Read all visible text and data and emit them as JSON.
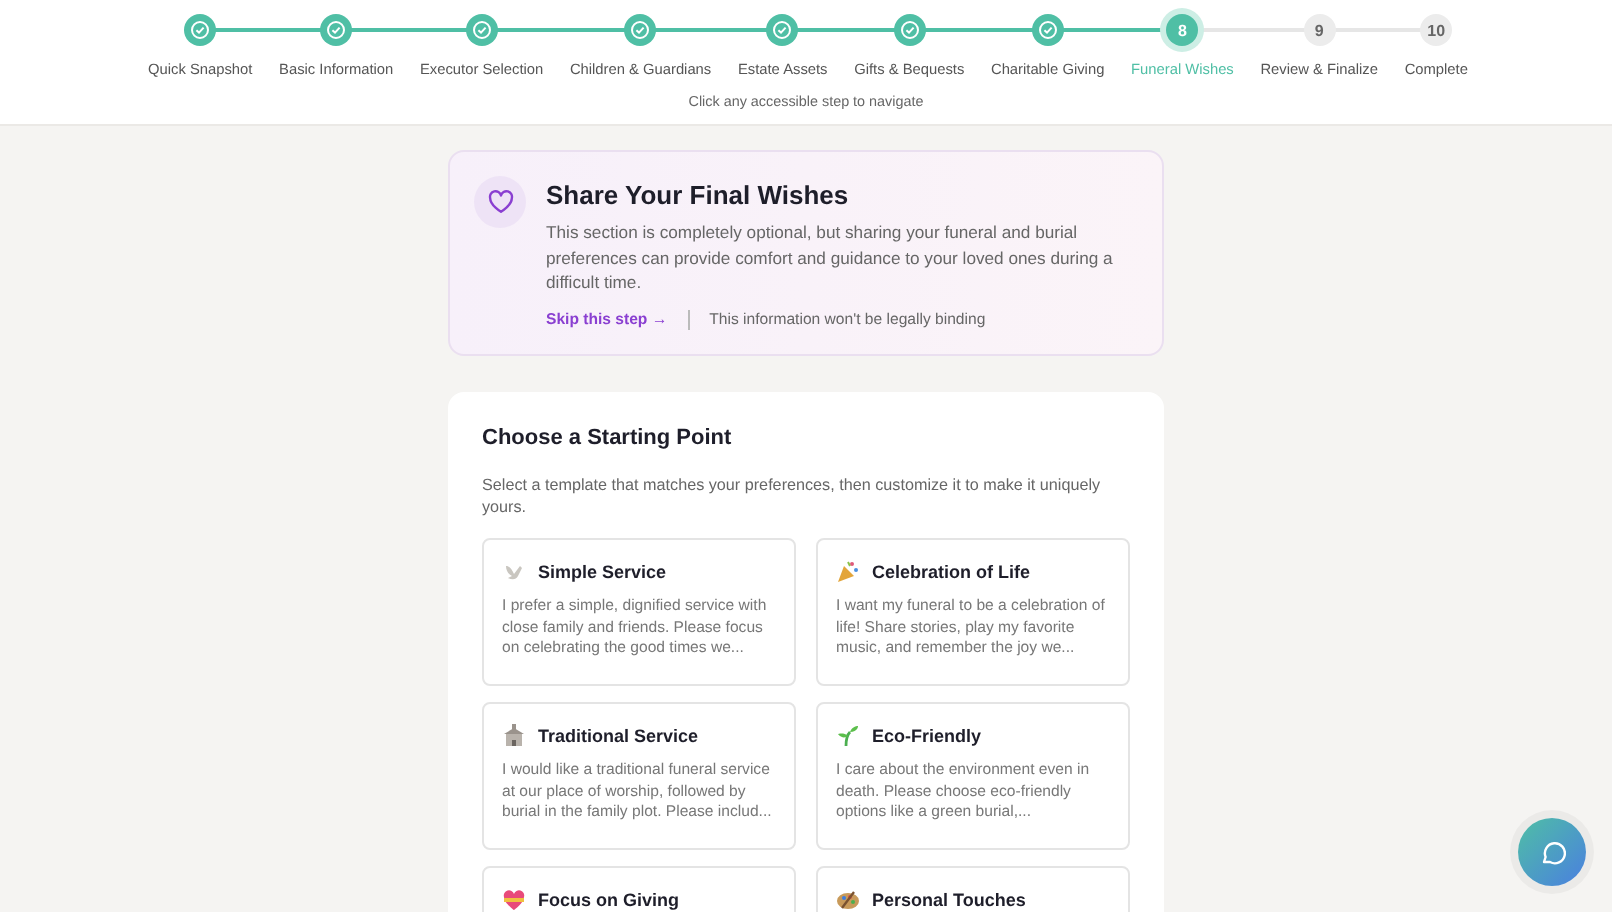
{
  "stepper": {
    "steps": [
      {
        "label": "Quick Snapshot",
        "completed": true,
        "selected": false
      },
      {
        "label": "Basic Information",
        "completed": true,
        "selected": false
      },
      {
        "label": "Executor Selection",
        "completed": true,
        "selected": false
      },
      {
        "label": "Children & Guardians",
        "completed": true,
        "selected": false
      },
      {
        "label": "Estate Assets",
        "completed": true,
        "selected": false
      },
      {
        "label": "Gifts & Bequests",
        "completed": true,
        "selected": false
      },
      {
        "label": "Charitable Giving",
        "completed": true,
        "selected": false
      },
      {
        "label": "Funeral Wishes",
        "number": "8",
        "completed": false,
        "selected": true
      },
      {
        "label": "Review & Finalize",
        "number": "9",
        "completed": false,
        "selected": false
      },
      {
        "label": "Complete",
        "number": "10",
        "completed": false,
        "selected": false
      }
    ],
    "hint": "Click any accessible step to navigate"
  },
  "intro": {
    "title": "Share Your Final Wishes",
    "text": "This section is completely optional, but sharing your funeral and burial preferences can provide comfort and guidance to your loved ones during a difficult time.",
    "skip_link": "Skip this step →",
    "note": "This information won't be legally binding"
  },
  "templates": {
    "title": "Choose a Starting Point",
    "subtitle": "Select a template that matches your preferences, then customize it to make it uniquely yours.",
    "items": [
      {
        "title": "Simple Service",
        "text": "I prefer a simple, dignified service with close family and friends. Please focus on celebrating the good times we..."
      },
      {
        "title": "Celebration of Life",
        "text": "I want my funeral to be a celebration of life! Share stories, play my favorite music, and remember the joy we..."
      },
      {
        "title": "Traditional Service",
        "text": "I would like a traditional funeral service at our place of worship, followed by burial in the family plot. Please includ..."
      },
      {
        "title": "Eco-Friendly",
        "text": "I care about the environment even in death. Please choose eco-friendly options like a green burial,..."
      },
      {
        "title": "Focus on Giving"
      },
      {
        "title": "Personal Touches"
      }
    ]
  }
}
